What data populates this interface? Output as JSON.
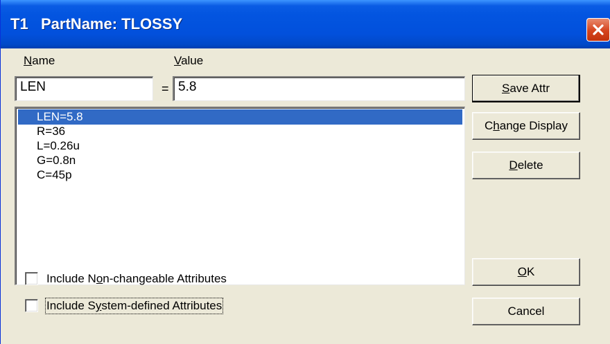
{
  "window": {
    "title": "T1   PartName: TLOSSY"
  },
  "icons": {
    "close": "close-icon"
  },
  "form": {
    "name_label_ul": "N",
    "name_label_rest": "ame",
    "value_label_ul": "V",
    "value_label_rest": "alue",
    "name_value": "LEN",
    "equals": "=",
    "value_value": "5.8"
  },
  "attributes": {
    "items": [
      {
        "label": "LEN=5.8",
        "selected": true
      },
      {
        "label": "R=36",
        "selected": false
      },
      {
        "label": "L=0.26u",
        "selected": false
      },
      {
        "label": "G=0.8n",
        "selected": false
      },
      {
        "label": "C=45p",
        "selected": false
      }
    ]
  },
  "buttons": {
    "save_attr_ul": "S",
    "save_attr_rest": "ave Attr",
    "change_display_pre": "C",
    "change_display_ul": "h",
    "change_display_rest": "ange Display",
    "delete_ul": "D",
    "delete_rest": "elete",
    "ok_ul": "O",
    "ok_rest": "K",
    "cancel": "Cancel"
  },
  "options": {
    "non_changeable_pre": "Include N",
    "non_changeable_ul": "o",
    "non_changeable_rest": "n-changeable Attributes",
    "non_changeable_checked": false,
    "system_defined_pre": "Include S",
    "system_defined_ul": "y",
    "system_defined_rest": "stem-defined Attributes",
    "system_defined_checked": false
  },
  "colors": {
    "titlebar": "#0355e0",
    "selection": "#316ac5",
    "dialog_bg": "#ece9d8",
    "close": "#d5441d"
  }
}
